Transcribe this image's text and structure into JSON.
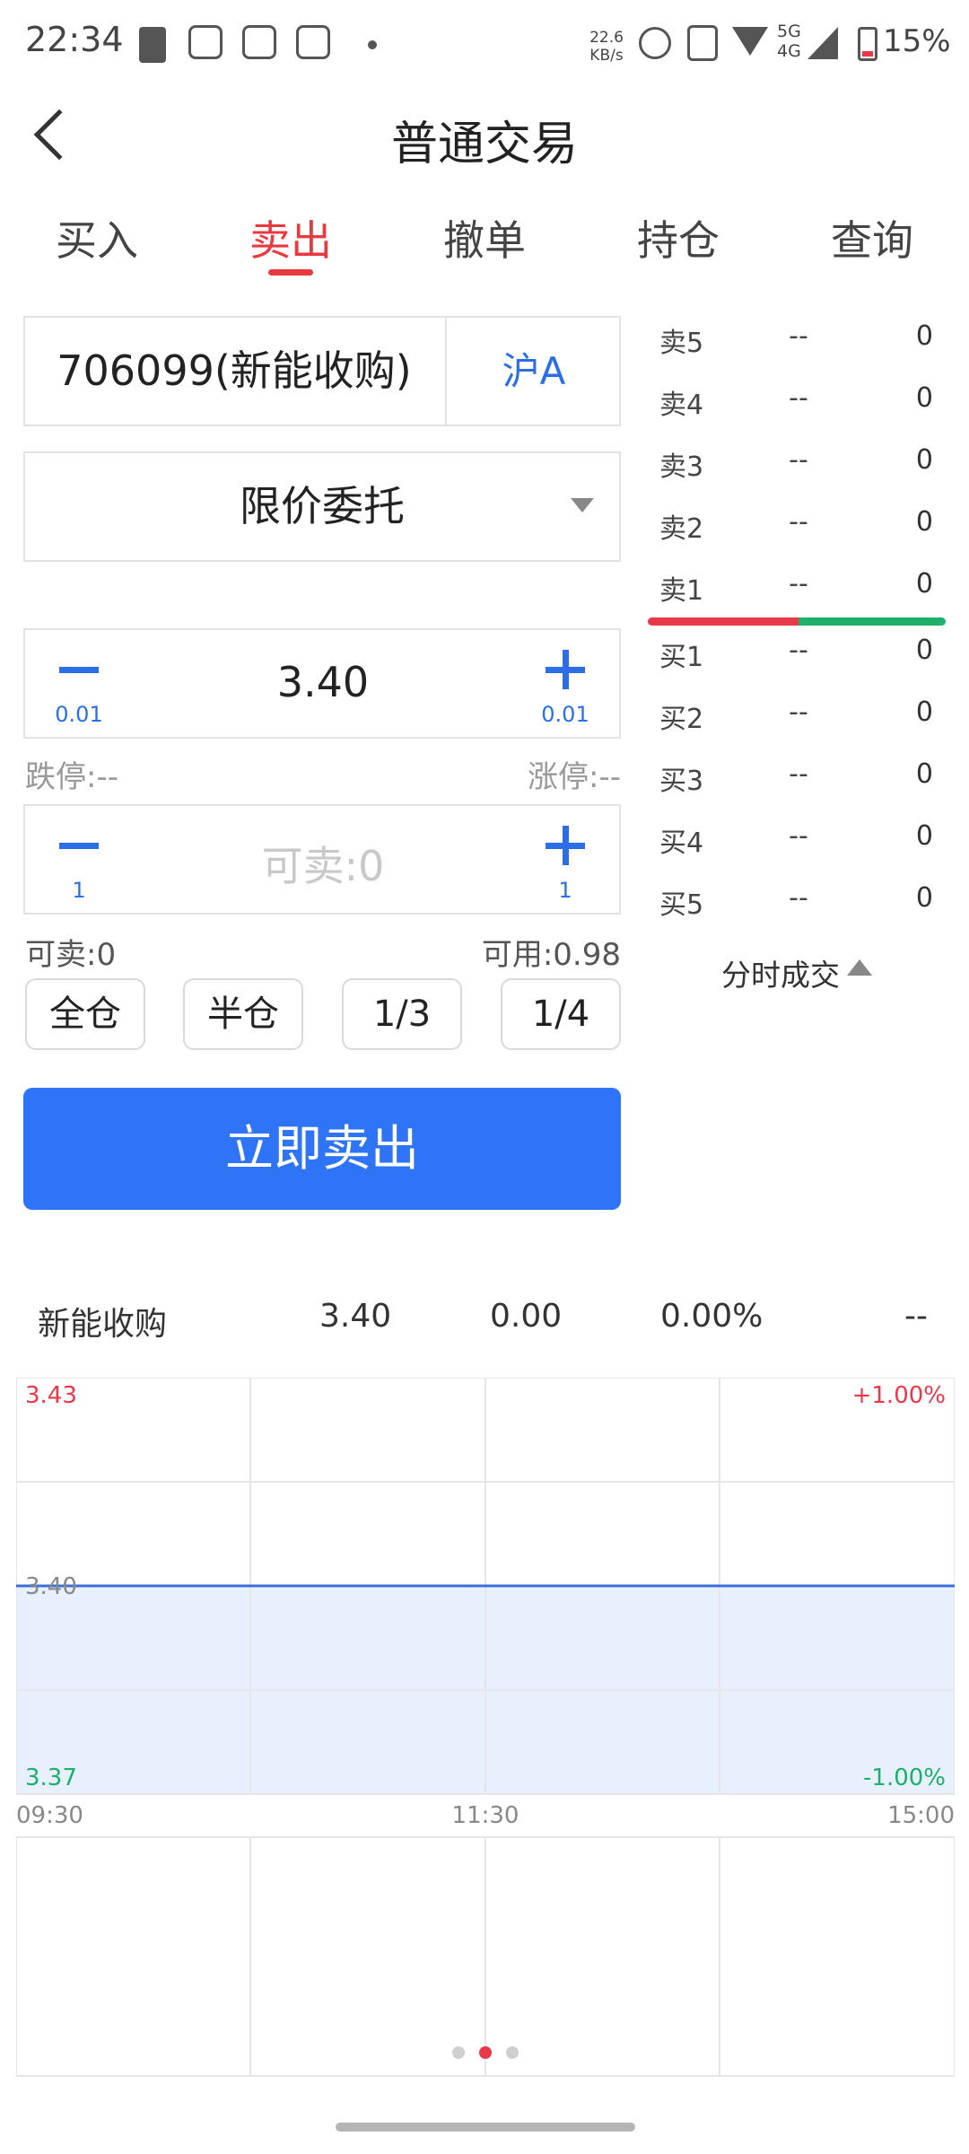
{
  "status_bar": {
    "time": "22:34",
    "net_speed_value": "22.6",
    "net_speed_unit": "KB/s",
    "network": "5G\n4G",
    "battery": "15%"
  },
  "header": {
    "title": "普通交易"
  },
  "tabs": [
    {
      "label": "买入"
    },
    {
      "label": "卖出",
      "active": true
    },
    {
      "label": "撤单"
    },
    {
      "label": "持仓"
    },
    {
      "label": "查询"
    }
  ],
  "form": {
    "stock_code": "706099(新能收购)",
    "market": "沪A",
    "order_type": "限价委托",
    "price": "3.40",
    "price_step": "0.01",
    "limit_down": "跌停:--",
    "limit_up": "涨停:--",
    "quantity_placeholder": "可卖:0",
    "quantity_step": "1",
    "sellable": "可卖:0",
    "available": "可用:0.98",
    "ratio_buttons": [
      "全仓",
      "半仓",
      "1/3",
      "1/4"
    ],
    "submit_label": "立即卖出"
  },
  "order_book": {
    "asks": [
      {
        "label": "卖5",
        "price": "--",
        "volume": "0"
      },
      {
        "label": "卖4",
        "price": "--",
        "volume": "0"
      },
      {
        "label": "卖3",
        "price": "--",
        "volume": "0"
      },
      {
        "label": "卖2",
        "price": "--",
        "volume": "0"
      },
      {
        "label": "卖1",
        "price": "--",
        "volume": "0"
      }
    ],
    "bids": [
      {
        "label": "买1",
        "price": "--",
        "volume": "0"
      },
      {
        "label": "买2",
        "price": "--",
        "volume": "0"
      },
      {
        "label": "买3",
        "price": "--",
        "volume": "0"
      },
      {
        "label": "买4",
        "price": "--",
        "volume": "0"
      },
      {
        "label": "买5",
        "price": "--",
        "volume": "0"
      }
    ],
    "ticks_toggle": "分时成交"
  },
  "quote": {
    "name": "新能收购",
    "price": "3.40",
    "change": "0.00",
    "change_pct": "0.00%",
    "extra": "--"
  },
  "chart": {
    "y_top": "3.43",
    "y_mid": "3.40",
    "y_bottom": "3.37",
    "pct_top": "+1.00%",
    "pct_bottom": "-1.00%",
    "x_start": "09:30",
    "x_mid": "11:30",
    "x_end": "15:00"
  },
  "colors": {
    "accent_red": "#e8393f",
    "accent_blue": "#2f73f6",
    "down_green": "#1eaf6a"
  },
  "chart_data": {
    "type": "line",
    "x": [
      "09:30",
      "11:30",
      "15:00"
    ],
    "series": [
      {
        "values": [
          3.4,
          3.4,
          3.4
        ]
      }
    ],
    "ylim": [
      3.37,
      3.43
    ],
    "grid": true
  }
}
